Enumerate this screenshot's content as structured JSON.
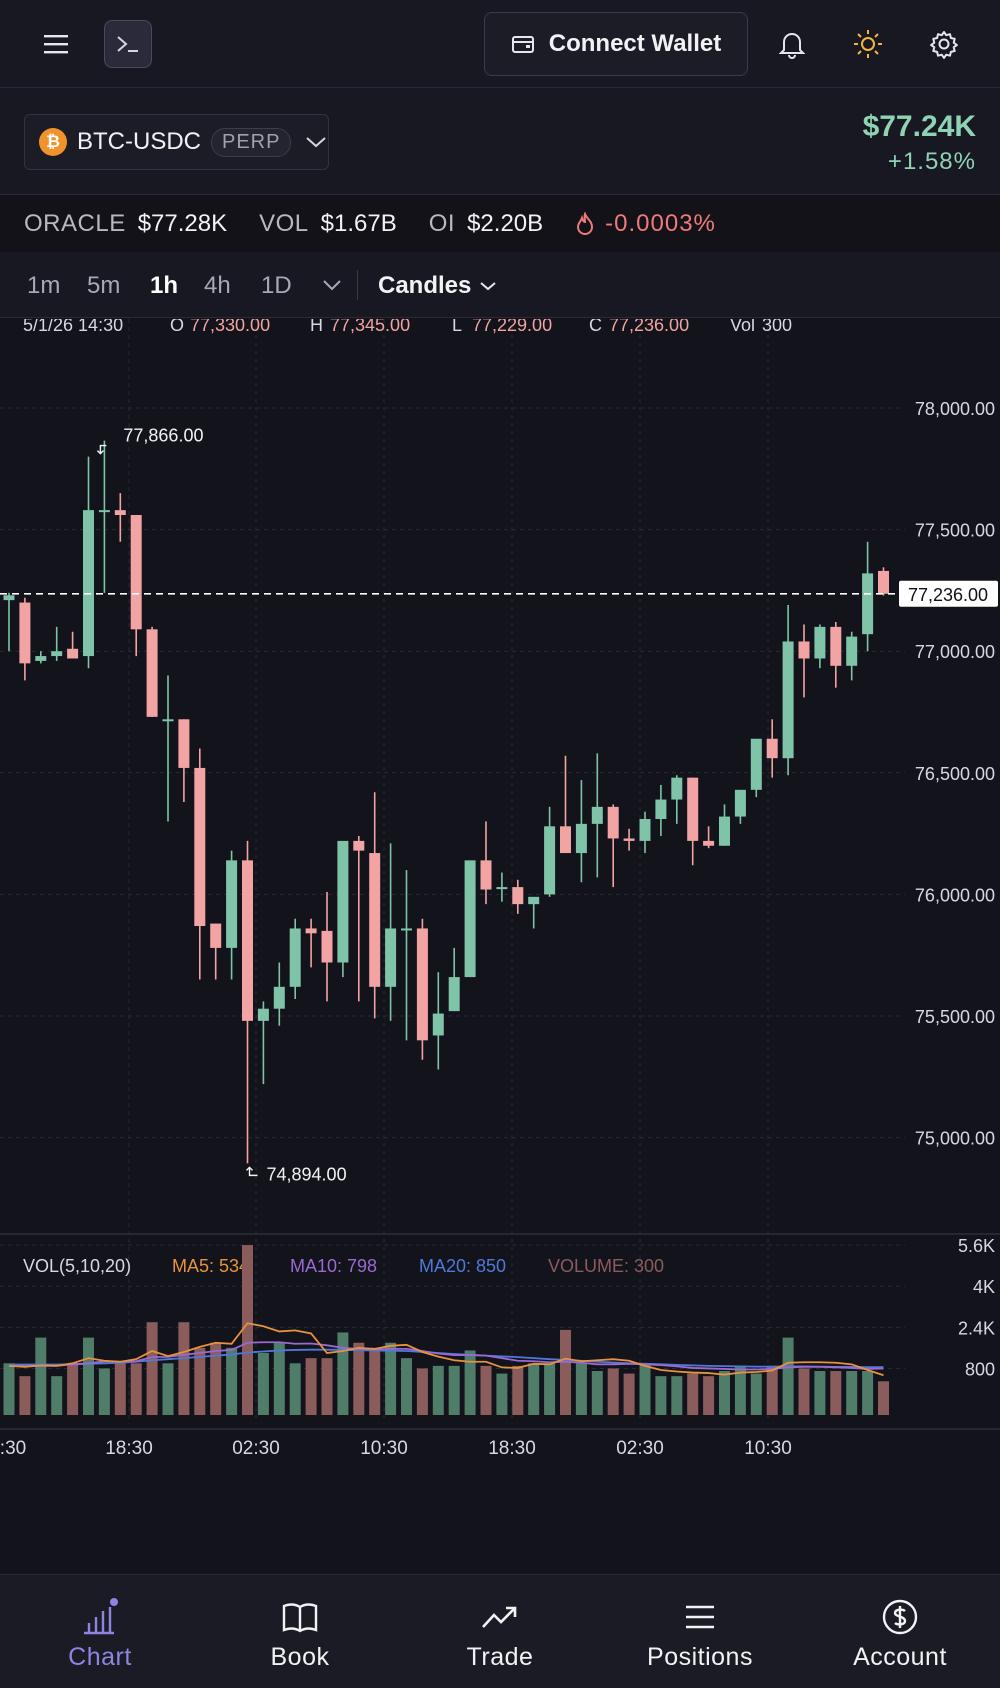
{
  "topbar": {
    "connect_label": "Connect Wallet",
    "icons": [
      "menu-icon",
      "terminal-icon",
      "wallet-icon",
      "bell-icon",
      "sun-icon",
      "gear-icon"
    ]
  },
  "market": {
    "coin_glyph": "₿",
    "pair": "BTC-USDC",
    "badge": "PERP",
    "price": "$77.24K",
    "change": "+1.58%"
  },
  "stats": {
    "oracle_label": "ORACLE",
    "oracle_value": "$77.28K",
    "vol_label": "VOL",
    "vol_value": "$1.67B",
    "oi_label": "OI",
    "oi_value": "$2.20B",
    "funding_value": "-0.0003%"
  },
  "timeframes": {
    "items": [
      "1m",
      "5m",
      "1h",
      "4h",
      "1D"
    ],
    "active": "1h",
    "chart_type": "Candles"
  },
  "colors": {
    "up": "#7fc4a8",
    "down": "#f2a3a3",
    "ma5": "#e7933d",
    "ma10": "#9a6ad0",
    "ma20": "#4f79d8",
    "accent": "#8d86e0"
  },
  "chart_data": {
    "type": "candlestick",
    "legend": {
      "time": "5/1/26 14:30",
      "o_label": "O",
      "o": "77,330.00",
      "h_label": "H",
      "h": "77,345.00",
      "l_label": "L",
      "l": "77,229.00",
      "c_label": "C",
      "c": "77,236.00",
      "vol_label": "Vol",
      "vol": "300"
    },
    "y_ticks": [
      "78,000.00",
      "77,500.00",
      "77,000.00",
      "76,500.00",
      "76,000.00",
      "75,500.00",
      "75,000.00"
    ],
    "y_tick_values": [
      78000,
      77500,
      77000,
      76500,
      76000,
      75500,
      75000
    ],
    "last_price": 77236,
    "last_price_label": "77,236.00",
    "high_marker": {
      "value": 77866,
      "label": "77,866.00"
    },
    "low_marker": {
      "value": 74894,
      "label": 74894,
      "label_text": "74,894.00"
    },
    "x_ticks": [
      ":30",
      "18:30",
      "02:30",
      "10:30",
      "18:30",
      "02:30",
      "10:30"
    ],
    "candles": [
      [
        77210,
        77240,
        77000,
        77230
      ],
      [
        77200,
        77220,
        76880,
        76950
      ],
      [
        76960,
        77000,
        76950,
        76980
      ],
      [
        76980,
        77100,
        76960,
        77000
      ],
      [
        77010,
        77080,
        76970,
        76970
      ],
      [
        76980,
        77800,
        76930,
        77580
      ],
      [
        77580,
        77866,
        77240,
        77580
      ],
      [
        77580,
        77650,
        77450,
        77560
      ],
      [
        77560,
        77560,
        76980,
        77090
      ],
      [
        77090,
        77100,
        76730,
        76730
      ],
      [
        76720,
        76900,
        76300,
        76720
      ],
      [
        76720,
        76720,
        76380,
        76520
      ],
      [
        76520,
        76600,
        75650,
        75870
      ],
      [
        75880,
        75880,
        75650,
        75780
      ],
      [
        75780,
        76180,
        75650,
        76140
      ],
      [
        76140,
        76220,
        74894,
        75480
      ],
      [
        75480,
        75560,
        75220,
        75530
      ],
      [
        75530,
        75720,
        75460,
        75620
      ],
      [
        75620,
        75900,
        75570,
        75860
      ],
      [
        75860,
        75900,
        75700,
        75840
      ],
      [
        75850,
        76010,
        75560,
        75720
      ],
      [
        75720,
        76080,
        75660,
        76220
      ],
      [
        76220,
        76240,
        75560,
        76180
      ],
      [
        76170,
        76420,
        75490,
        75620
      ],
      [
        75620,
        76210,
        75480,
        75860
      ],
      [
        75860,
        76100,
        75400,
        75860
      ],
      [
        75860,
        75900,
        75320,
        75400
      ],
      [
        75420,
        75680,
        75280,
        75510
      ],
      [
        75520,
        75780,
        75520,
        75660
      ],
      [
        75660,
        76020,
        75660,
        76140
      ],
      [
        76140,
        76300,
        75960,
        76020
      ],
      [
        76030,
        76090,
        75970,
        76030
      ],
      [
        76030,
        76060,
        75920,
        75960
      ],
      [
        75960,
        75980,
        75860,
        75990
      ],
      [
        76000,
        76360,
        75990,
        76280
      ],
      [
        76280,
        76570,
        76260,
        76170
      ],
      [
        76170,
        76470,
        76050,
        76290
      ],
      [
        76290,
        76580,
        76070,
        76360
      ],
      [
        76360,
        76370,
        76030,
        76230
      ],
      [
        76230,
        76270,
        76180,
        76220
      ],
      [
        76220,
        76340,
        76170,
        76310
      ],
      [
        76310,
        76450,
        76240,
        76390
      ],
      [
        76390,
        76490,
        76290,
        76480
      ],
      [
        76480,
        76480,
        76120,
        76220
      ],
      [
        76220,
        76280,
        76190,
        76200
      ],
      [
        76200,
        76370,
        76200,
        76320
      ],
      [
        76320,
        76420,
        76290,
        76430
      ],
      [
        76430,
        76620,
        76400,
        76640
      ],
      [
        76640,
        76720,
        76480,
        76560
      ],
      [
        76560,
        77190,
        76490,
        77040
      ],
      [
        77040,
        77110,
        76810,
        76970
      ],
      [
        76970,
        77110,
        76930,
        77100
      ],
      [
        77100,
        77120,
        76850,
        76940
      ],
      [
        76940,
        77080,
        76880,
        77060
      ],
      [
        77070,
        77450,
        77000,
        77320
      ],
      [
        77330,
        77345,
        77229,
        77236
      ]
    ],
    "volume": {
      "label": "VOL(5,10,20)",
      "ma5_label": "MA5: 534",
      "ma10_label": "MA10: 798",
      "ma20_label": "MA20: 850",
      "volume_label": "VOLUME: 300",
      "ticks": [
        "5.6K",
        "4K",
        "2.4K",
        "800"
      ],
      "tick_values": [
        5600,
        4000,
        2400,
        800
      ],
      "values": [
        1000,
        500,
        2000,
        500,
        1000,
        2000,
        800,
        1000,
        1000,
        2600,
        1000,
        2600,
        1600,
        1800,
        1600,
        5600,
        1400,
        1800,
        1000,
        1200,
        1200,
        2200,
        1800,
        1600,
        1800,
        1200,
        800,
        900,
        900,
        1500,
        900,
        600,
        900,
        1000,
        1000,
        2300,
        1000,
        700,
        800,
        600,
        1000,
        500,
        500,
        600,
        500,
        700,
        900,
        600,
        900,
        2000,
        800,
        700,
        700,
        700,
        700,
        300
      ],
      "ma5": [
        900,
        860,
        920,
        900,
        1000,
        1200,
        1100,
        1060,
        1160,
        1480,
        1280,
        1440,
        1640,
        1800,
        1760,
        2560,
        2440,
        2240,
        2280,
        2160,
        1400,
        1480,
        1600,
        1560,
        1680,
        1720,
        1440,
        1260,
        1120,
        1060,
        1060,
        840,
        820,
        980,
        960,
        1180,
        1080,
        1120,
        1160,
        1100,
        900,
        740,
        680,
        640,
        620,
        560,
        640,
        660,
        720,
        1020,
        1040,
        1040,
        1020,
        960,
        740,
        534
      ],
      "ma10": [
        900,
        880,
        900,
        900,
        960,
        1000,
        1080,
        1060,
        1080,
        1240,
        1250,
        1330,
        1400,
        1480,
        1520,
        1800,
        1820,
        1820,
        1760,
        1770,
        1700,
        1600,
        1560,
        1540,
        1560,
        1560,
        1480,
        1380,
        1320,
        1320,
        1300,
        1200,
        1100,
        1080,
        1040,
        1060,
        1020,
        960,
        960,
        980,
        960,
        930,
        880,
        820,
        800,
        780,
        760,
        760,
        780,
        840,
        860,
        860,
        840,
        820,
        780,
        798
      ],
      "ma20": [
        950,
        950,
        950,
        950,
        960,
        980,
        1000,
        1020,
        1060,
        1120,
        1160,
        1200,
        1250,
        1300,
        1340,
        1420,
        1460,
        1500,
        1520,
        1530,
        1530,
        1520,
        1510,
        1500,
        1490,
        1480,
        1440,
        1400,
        1360,
        1330,
        1300,
        1270,
        1240,
        1200,
        1160,
        1130,
        1100,
        1060,
        1030,
        1000,
        980,
        960,
        940,
        920,
        900,
        890,
        880,
        870,
        870,
        880,
        880,
        870,
        860,
        860,
        850,
        850
      ]
    }
  },
  "nav": {
    "items": [
      {
        "label": "Chart",
        "icon": "chart-icon"
      },
      {
        "label": "Book",
        "icon": "book-icon"
      },
      {
        "label": "Trade",
        "icon": "trend-icon"
      },
      {
        "label": "Positions",
        "icon": "list-icon"
      },
      {
        "label": "Account",
        "icon": "dollar-icon"
      }
    ],
    "active": "Chart"
  }
}
